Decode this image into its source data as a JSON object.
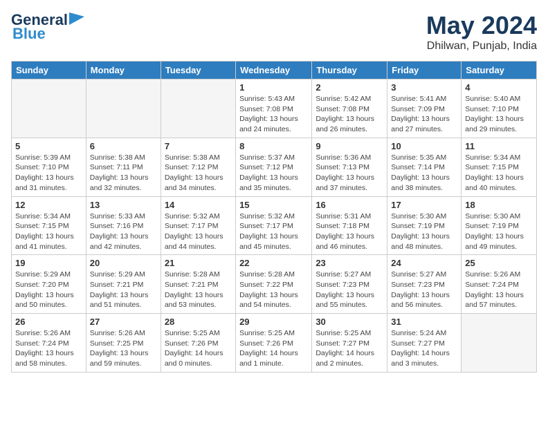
{
  "logo": {
    "general": "General",
    "blue": "Blue"
  },
  "header": {
    "month": "May 2024",
    "location": "Dhilwan, Punjab, India"
  },
  "weekdays": [
    "Sunday",
    "Monday",
    "Tuesday",
    "Wednesday",
    "Thursday",
    "Friday",
    "Saturday"
  ],
  "weeks": [
    [
      {
        "day": "",
        "info": ""
      },
      {
        "day": "",
        "info": ""
      },
      {
        "day": "",
        "info": ""
      },
      {
        "day": "1",
        "info": "Sunrise: 5:43 AM\nSunset: 7:08 PM\nDaylight: 13 hours\nand 24 minutes."
      },
      {
        "day": "2",
        "info": "Sunrise: 5:42 AM\nSunset: 7:08 PM\nDaylight: 13 hours\nand 26 minutes."
      },
      {
        "day": "3",
        "info": "Sunrise: 5:41 AM\nSunset: 7:09 PM\nDaylight: 13 hours\nand 27 minutes."
      },
      {
        "day": "4",
        "info": "Sunrise: 5:40 AM\nSunset: 7:10 PM\nDaylight: 13 hours\nand 29 minutes."
      }
    ],
    [
      {
        "day": "5",
        "info": "Sunrise: 5:39 AM\nSunset: 7:10 PM\nDaylight: 13 hours\nand 31 minutes."
      },
      {
        "day": "6",
        "info": "Sunrise: 5:38 AM\nSunset: 7:11 PM\nDaylight: 13 hours\nand 32 minutes."
      },
      {
        "day": "7",
        "info": "Sunrise: 5:38 AM\nSunset: 7:12 PM\nDaylight: 13 hours\nand 34 minutes."
      },
      {
        "day": "8",
        "info": "Sunrise: 5:37 AM\nSunset: 7:12 PM\nDaylight: 13 hours\nand 35 minutes."
      },
      {
        "day": "9",
        "info": "Sunrise: 5:36 AM\nSunset: 7:13 PM\nDaylight: 13 hours\nand 37 minutes."
      },
      {
        "day": "10",
        "info": "Sunrise: 5:35 AM\nSunset: 7:14 PM\nDaylight: 13 hours\nand 38 minutes."
      },
      {
        "day": "11",
        "info": "Sunrise: 5:34 AM\nSunset: 7:15 PM\nDaylight: 13 hours\nand 40 minutes."
      }
    ],
    [
      {
        "day": "12",
        "info": "Sunrise: 5:34 AM\nSunset: 7:15 PM\nDaylight: 13 hours\nand 41 minutes."
      },
      {
        "day": "13",
        "info": "Sunrise: 5:33 AM\nSunset: 7:16 PM\nDaylight: 13 hours\nand 42 minutes."
      },
      {
        "day": "14",
        "info": "Sunrise: 5:32 AM\nSunset: 7:17 PM\nDaylight: 13 hours\nand 44 minutes."
      },
      {
        "day": "15",
        "info": "Sunrise: 5:32 AM\nSunset: 7:17 PM\nDaylight: 13 hours\nand 45 minutes."
      },
      {
        "day": "16",
        "info": "Sunrise: 5:31 AM\nSunset: 7:18 PM\nDaylight: 13 hours\nand 46 minutes."
      },
      {
        "day": "17",
        "info": "Sunrise: 5:30 AM\nSunset: 7:19 PM\nDaylight: 13 hours\nand 48 minutes."
      },
      {
        "day": "18",
        "info": "Sunrise: 5:30 AM\nSunset: 7:19 PM\nDaylight: 13 hours\nand 49 minutes."
      }
    ],
    [
      {
        "day": "19",
        "info": "Sunrise: 5:29 AM\nSunset: 7:20 PM\nDaylight: 13 hours\nand 50 minutes."
      },
      {
        "day": "20",
        "info": "Sunrise: 5:29 AM\nSunset: 7:21 PM\nDaylight: 13 hours\nand 51 minutes."
      },
      {
        "day": "21",
        "info": "Sunrise: 5:28 AM\nSunset: 7:21 PM\nDaylight: 13 hours\nand 53 minutes."
      },
      {
        "day": "22",
        "info": "Sunrise: 5:28 AM\nSunset: 7:22 PM\nDaylight: 13 hours\nand 54 minutes."
      },
      {
        "day": "23",
        "info": "Sunrise: 5:27 AM\nSunset: 7:23 PM\nDaylight: 13 hours\nand 55 minutes."
      },
      {
        "day": "24",
        "info": "Sunrise: 5:27 AM\nSunset: 7:23 PM\nDaylight: 13 hours\nand 56 minutes."
      },
      {
        "day": "25",
        "info": "Sunrise: 5:26 AM\nSunset: 7:24 PM\nDaylight: 13 hours\nand 57 minutes."
      }
    ],
    [
      {
        "day": "26",
        "info": "Sunrise: 5:26 AM\nSunset: 7:24 PM\nDaylight: 13 hours\nand 58 minutes."
      },
      {
        "day": "27",
        "info": "Sunrise: 5:26 AM\nSunset: 7:25 PM\nDaylight: 13 hours\nand 59 minutes."
      },
      {
        "day": "28",
        "info": "Sunrise: 5:25 AM\nSunset: 7:26 PM\nDaylight: 14 hours\nand 0 minutes."
      },
      {
        "day": "29",
        "info": "Sunrise: 5:25 AM\nSunset: 7:26 PM\nDaylight: 14 hours\nand 1 minute."
      },
      {
        "day": "30",
        "info": "Sunrise: 5:25 AM\nSunset: 7:27 PM\nDaylight: 14 hours\nand 2 minutes."
      },
      {
        "day": "31",
        "info": "Sunrise: 5:24 AM\nSunset: 7:27 PM\nDaylight: 14 hours\nand 3 minutes."
      },
      {
        "day": "",
        "info": ""
      }
    ]
  ]
}
